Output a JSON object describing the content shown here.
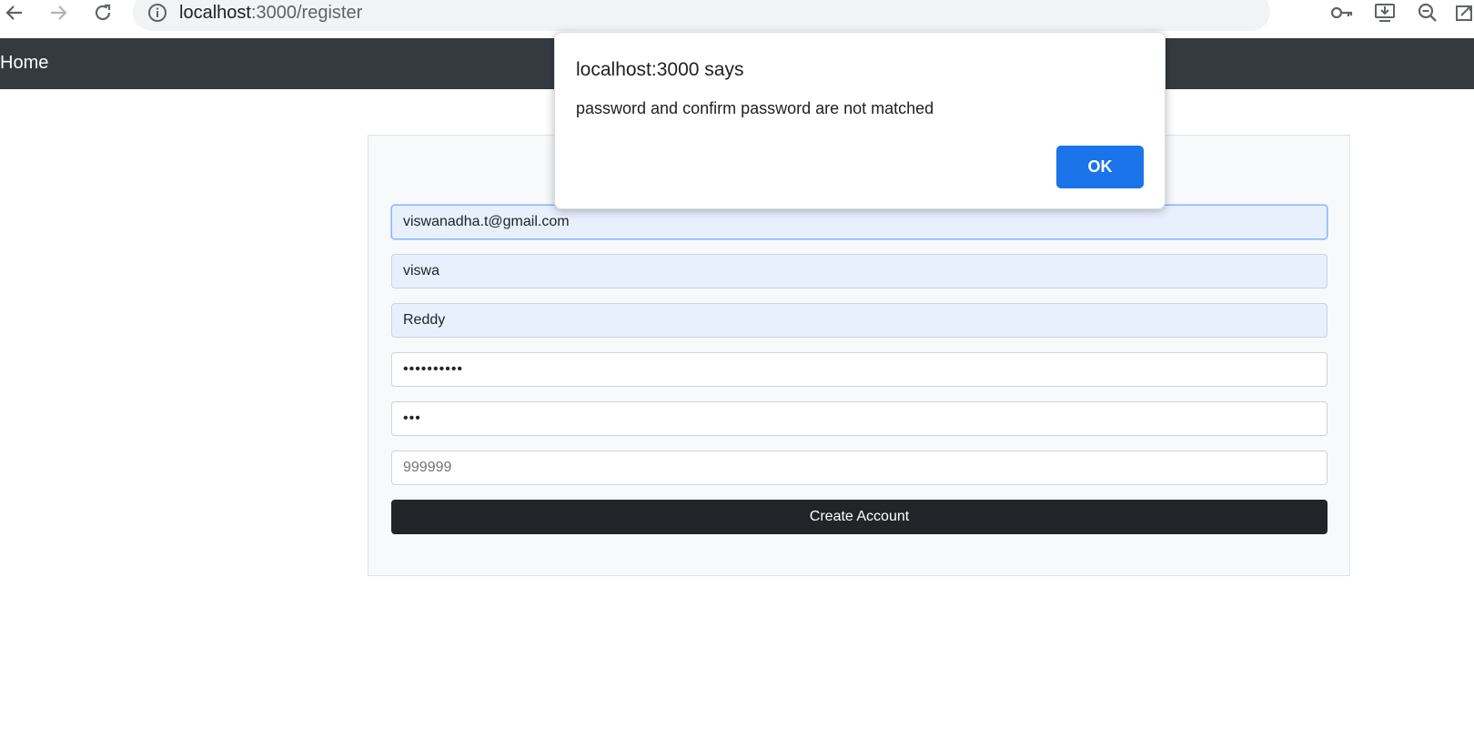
{
  "browser": {
    "url_host": "localhost",
    "url_path": ":3000/register",
    "icons": [
      "back-arrow-icon",
      "forward-arrow-icon",
      "reload-icon",
      "info-icon",
      "key-icon",
      "install-icon",
      "zoom-out-icon",
      "share-icon"
    ]
  },
  "navbar": {
    "brand": "Home",
    "background": "#343a40"
  },
  "form": {
    "email_value": "viswanadha.t@gmail.com",
    "first_name_value": "viswa",
    "last_name_value": "Reddy",
    "password_value": "••••••••••",
    "confirm_password_value": "•••",
    "phone_placeholder": "999999",
    "submit_label": "Create Account"
  },
  "dialog": {
    "title": "localhost:3000 says",
    "message": "password and confirm password are not matched",
    "ok_label": "OK",
    "accent": "#1a73e8"
  }
}
